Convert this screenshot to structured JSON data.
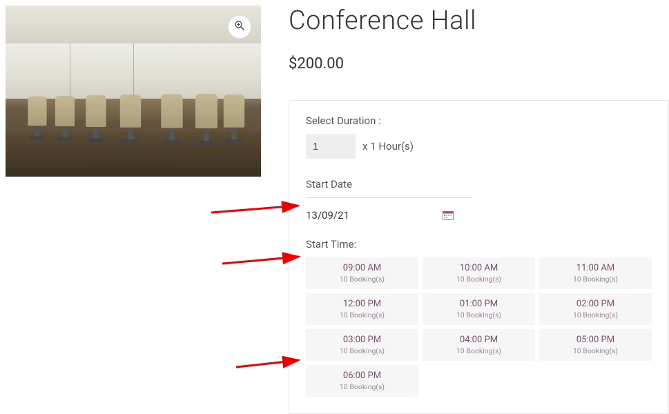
{
  "product": {
    "title": "Conference Hall",
    "price": "$200.00"
  },
  "zoom_icon_label": "zoom",
  "booking": {
    "duration_label": "Select Duration :",
    "duration_value": "1",
    "duration_suffix": "x 1 Hour(s)",
    "start_date_label": "Start Date",
    "start_date_value": "13/09/21",
    "start_time_label": "Start Time:",
    "time_slots": [
      {
        "time": "09:00 AM",
        "sub": "10 Booking(s)"
      },
      {
        "time": "10:00 AM",
        "sub": "10 Booking(s)"
      },
      {
        "time": "11:00 AM",
        "sub": "10 Booking(s)"
      },
      {
        "time": "12:00 PM",
        "sub": "10 Booking(s)"
      },
      {
        "time": "01:00 PM",
        "sub": "10 Booking(s)"
      },
      {
        "time": "02:00 PM",
        "sub": "10 Booking(s)"
      },
      {
        "time": "03:00 PM",
        "sub": "10 Booking(s)"
      },
      {
        "time": "04:00 PM",
        "sub": "10 Booking(s)"
      },
      {
        "time": "05:00 PM",
        "sub": "10 Booking(s)"
      },
      {
        "time": "06:00 PM",
        "sub": "10 Booking(s)"
      }
    ]
  }
}
